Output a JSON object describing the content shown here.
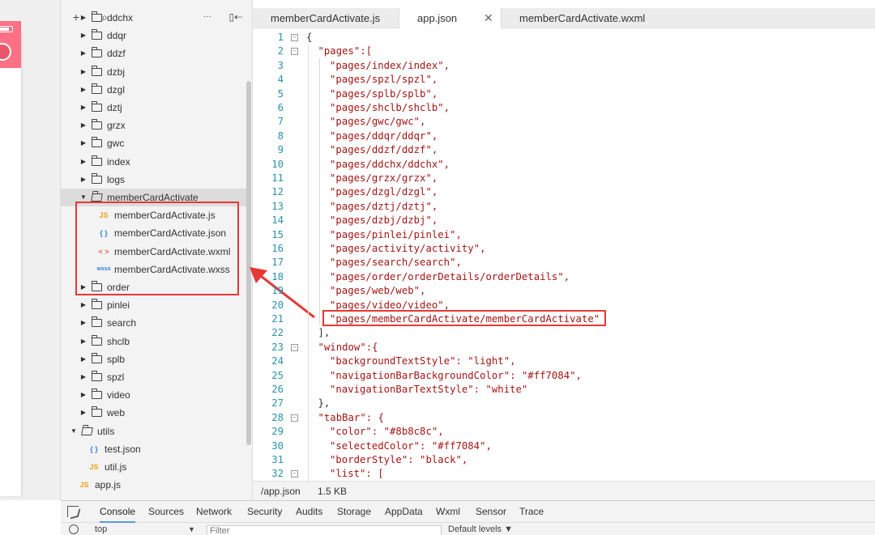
{
  "toolbar": {
    "add": "+",
    "search": "⌕",
    "more": "···",
    "collapse": "▯⇠"
  },
  "tree": [
    {
      "label": "ddchx",
      "type": "folder",
      "depth": 1,
      "open": false
    },
    {
      "label": "ddqr",
      "type": "folder",
      "depth": 1,
      "open": false
    },
    {
      "label": "ddzf",
      "type": "folder",
      "depth": 1,
      "open": false
    },
    {
      "label": "dzbj",
      "type": "folder",
      "depth": 1,
      "open": false
    },
    {
      "label": "dzgl",
      "type": "folder",
      "depth": 1,
      "open": false
    },
    {
      "label": "dztj",
      "type": "folder",
      "depth": 1,
      "open": false
    },
    {
      "label": "grzx",
      "type": "folder",
      "depth": 1,
      "open": false
    },
    {
      "label": "gwc",
      "type": "folder",
      "depth": 1,
      "open": false
    },
    {
      "label": "index",
      "type": "folder",
      "depth": 1,
      "open": false
    },
    {
      "label": "logs",
      "type": "folder",
      "depth": 1,
      "open": false
    },
    {
      "label": "memberCardActivate",
      "type": "folder",
      "depth": 1,
      "open": true,
      "selected": true
    },
    {
      "label": "memberCardActivate.js",
      "type": "js",
      "depth": 2,
      "icon": "JS"
    },
    {
      "label": "memberCardActivate.json",
      "type": "json",
      "depth": 2,
      "icon": "{ }"
    },
    {
      "label": "memberCardActivate.wxml",
      "type": "wxml",
      "depth": 2,
      "icon": "< >"
    },
    {
      "label": "memberCardActivate.wxss",
      "type": "wxss",
      "depth": 2,
      "icon": "wxss"
    },
    {
      "label": "order",
      "type": "folder",
      "depth": 1,
      "open": false
    },
    {
      "label": "pinlei",
      "type": "folder",
      "depth": 1,
      "open": false
    },
    {
      "label": "search",
      "type": "folder",
      "depth": 1,
      "open": false
    },
    {
      "label": "shclb",
      "type": "folder",
      "depth": 1,
      "open": false
    },
    {
      "label": "splb",
      "type": "folder",
      "depth": 1,
      "open": false
    },
    {
      "label": "spzl",
      "type": "folder",
      "depth": 1,
      "open": false
    },
    {
      "label": "video",
      "type": "folder",
      "depth": 1,
      "open": false
    },
    {
      "label": "web",
      "type": "folder",
      "depth": 1,
      "open": false
    },
    {
      "label": "utils",
      "type": "folder",
      "depth": 0,
      "open": true
    },
    {
      "label": "test.json",
      "type": "json",
      "depth": 1,
      "icon": "{ }"
    },
    {
      "label": "util.js",
      "type": "js",
      "depth": 1,
      "icon": "JS"
    },
    {
      "label": "app.js",
      "type": "js",
      "depth": 0,
      "icon": "JS"
    }
  ],
  "tabs": [
    {
      "label": "memberCardActivate.js",
      "active": false
    },
    {
      "label": "app.json",
      "active": true,
      "close": "✕"
    },
    {
      "label": "memberCardActivate.wxml",
      "active": false
    }
  ],
  "code": [
    {
      "n": "1",
      "fold": "⊟",
      "indent": 0,
      "text": "{"
    },
    {
      "n": "2",
      "fold": "⊟",
      "indent": 1,
      "text": "\"pages\":["
    },
    {
      "n": "3",
      "indent": 2,
      "text": "\"pages/index/index\","
    },
    {
      "n": "4",
      "indent": 2,
      "text": "\"pages/spzl/spzl\","
    },
    {
      "n": "5",
      "indent": 2,
      "text": "\"pages/splb/splb\","
    },
    {
      "n": "6",
      "indent": 2,
      "text": "\"pages/shclb/shclb\","
    },
    {
      "n": "7",
      "indent": 2,
      "text": "\"pages/gwc/gwc\","
    },
    {
      "n": "8",
      "indent": 2,
      "text": "\"pages/ddqr/ddqr\","
    },
    {
      "n": "9",
      "indent": 2,
      "text": "\"pages/ddzf/ddzf\","
    },
    {
      "n": "10",
      "indent": 2,
      "text": "\"pages/ddchx/ddchx\","
    },
    {
      "n": "11",
      "indent": 2,
      "text": "\"pages/grzx/grzx\","
    },
    {
      "n": "12",
      "indent": 2,
      "text": "\"pages/dzgl/dzgl\","
    },
    {
      "n": "13",
      "indent": 2,
      "text": "\"pages/dztj/dztj\","
    },
    {
      "n": "14",
      "indent": 2,
      "text": "\"pages/dzbj/dzbj\","
    },
    {
      "n": "15",
      "indent": 2,
      "text": "\"pages/pinlei/pinlei\","
    },
    {
      "n": "16",
      "indent": 2,
      "text": "\"pages/activity/activity\","
    },
    {
      "n": "17",
      "indent": 2,
      "text": "\"pages/search/search\","
    },
    {
      "n": "18",
      "indent": 2,
      "text": "\"pages/order/orderDetails/orderDetails\","
    },
    {
      "n": "19",
      "indent": 2,
      "text": "\"pages/web/web\","
    },
    {
      "n": "20",
      "indent": 2,
      "text": "\"pages/video/video\","
    },
    {
      "n": "21",
      "indent": 2,
      "text": "\"pages/memberCardActivate/memberCardActivate\""
    },
    {
      "n": "22",
      "indent": 1,
      "text": "],"
    },
    {
      "n": "23",
      "fold": "⊟",
      "indent": 1,
      "text": "\"window\":{"
    },
    {
      "n": "24",
      "indent": 2,
      "text": "\"backgroundTextStyle\": \"light\","
    },
    {
      "n": "25",
      "indent": 2,
      "text": "\"navigationBarBackgroundColor\": \"#ff7084\","
    },
    {
      "n": "26",
      "indent": 2,
      "text": "\"navigationBarTextStyle\": \"white\""
    },
    {
      "n": "27",
      "indent": 1,
      "text": "},"
    },
    {
      "n": "28",
      "fold": "⊟",
      "indent": 1,
      "text": "\"tabBar\": {"
    },
    {
      "n": "29",
      "indent": 2,
      "text": "\"color\": \"#8b8c8c\","
    },
    {
      "n": "30",
      "indent": 2,
      "text": "\"selectedColor\": \"#ff7084\","
    },
    {
      "n": "31",
      "indent": 2,
      "text": "\"borderStyle\": \"black\","
    },
    {
      "n": "32",
      "fold": "⊟",
      "indent": 2,
      "text": "\"list\": ["
    }
  ],
  "status": {
    "path": "/app.json",
    "size": "1.5 KB"
  },
  "devtools": {
    "tabs": [
      "Console",
      "Sources",
      "Network",
      "Security",
      "Audits",
      "Storage",
      "AppData",
      "Wxml",
      "Sensor",
      "Trace"
    ],
    "active": "Console",
    "context": "top",
    "filter_placeholder": "Filter",
    "levels": "Default levels ▼"
  },
  "colors": {
    "accent": "#ff7084",
    "highlight": "#e53935"
  }
}
